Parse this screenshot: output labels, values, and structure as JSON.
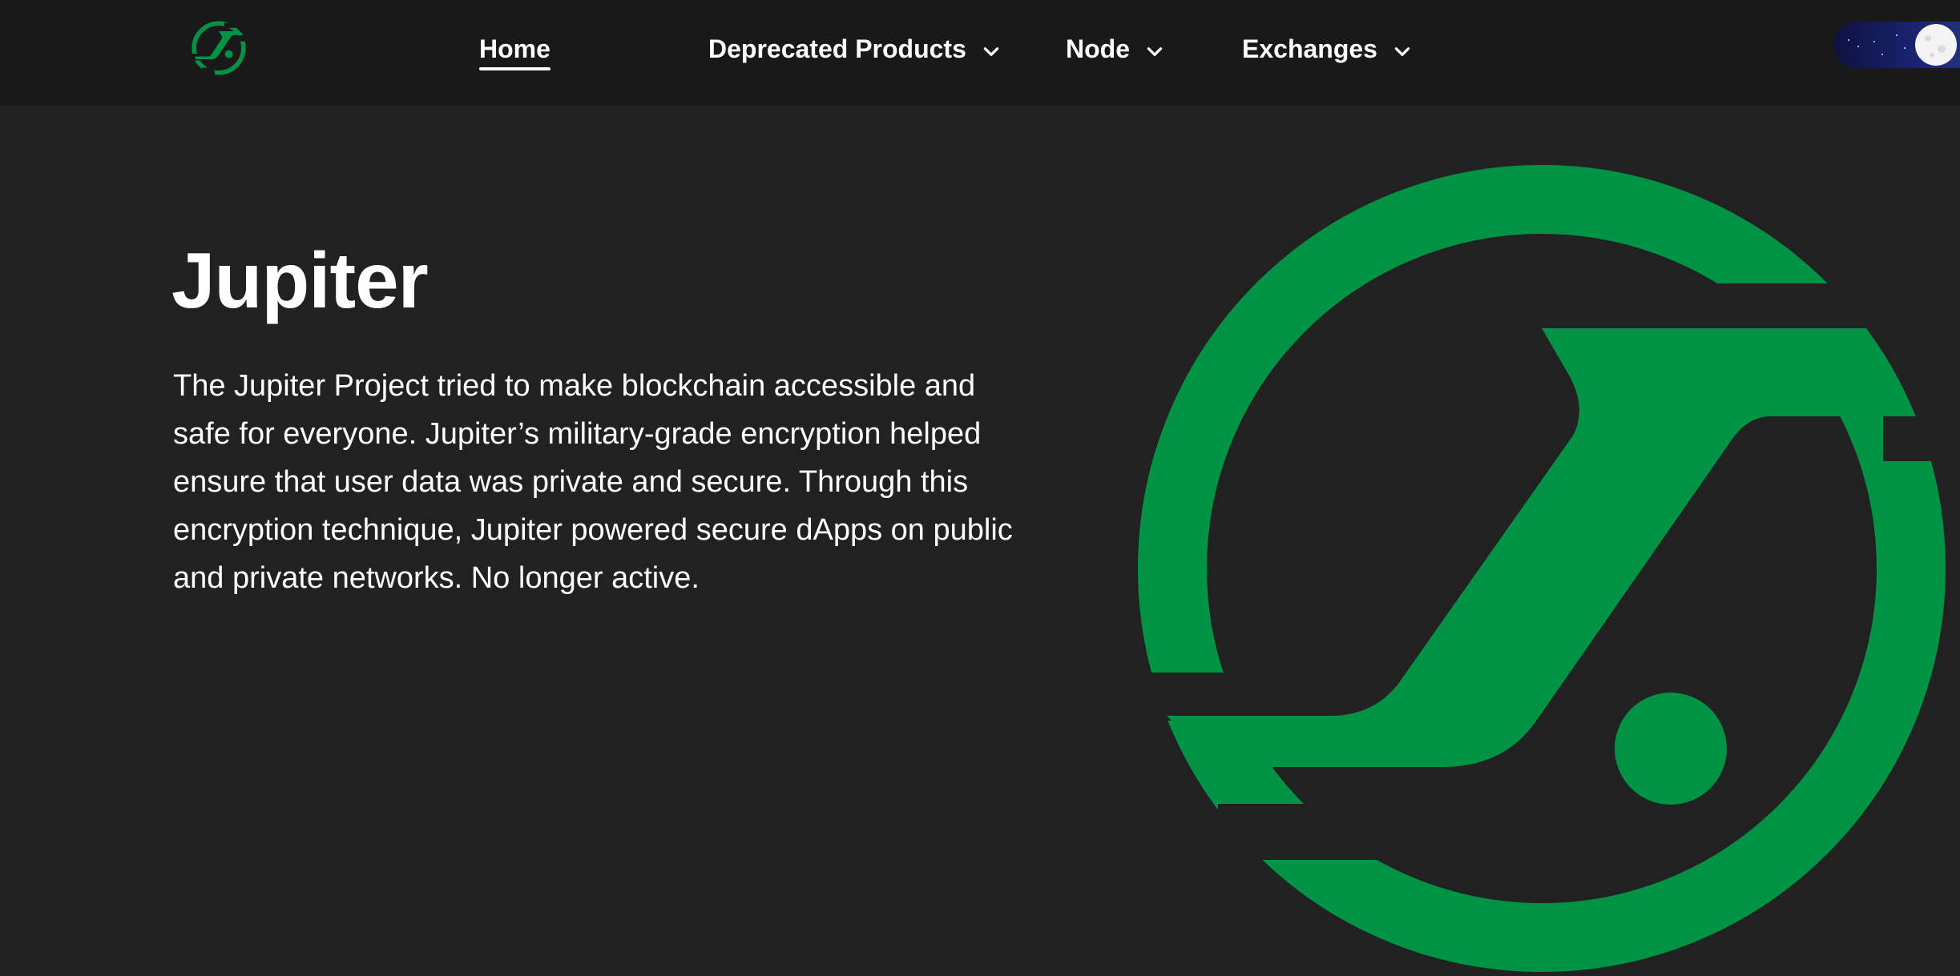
{
  "nav": {
    "logo_icon": "jupiter-logo-icon",
    "items": [
      {
        "label": "Home",
        "active": true,
        "has_dropdown": false
      },
      {
        "label": "Deprecated Products",
        "active": false,
        "has_dropdown": true
      },
      {
        "label": "Node",
        "active": false,
        "has_dropdown": true
      },
      {
        "label": "Exchanges",
        "active": false,
        "has_dropdown": true
      }
    ],
    "theme_toggle": {
      "mode": "dark",
      "icon": "moon-icon"
    }
  },
  "hero": {
    "title": "Jupiter",
    "description": "The Jupiter Project tried to make blockchain accessible and safe for everyone. Jupiter’s military-grade encryption helped ensure that user data was private and secure. Through this encryption technique, Jupiter powered secure dApps on public and private networks. No longer active.",
    "illustration_icon": "jupiter-logo-icon"
  },
  "colors": {
    "brand_green": "#009245",
    "background": "#212121",
    "navbar_background": "#191919",
    "text": "#ffffff"
  }
}
